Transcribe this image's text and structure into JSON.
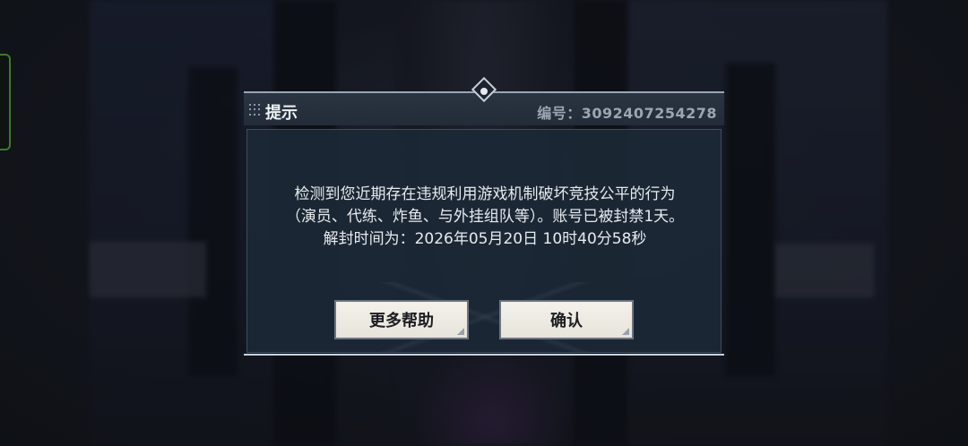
{
  "dialog": {
    "title": "提示",
    "id_text": "编号：3092407254278",
    "message_lines": [
      "检测到您近期存在违规利用游戏机制破坏竞技公平的行为",
      "（演员、代练、炸鱼、与外挂组队等）。账号已被封禁1天。",
      "解封时间为：2026年05月20日 10时40分58秒"
    ],
    "buttons": {
      "help": "更多帮助",
      "confirm": "确认"
    }
  },
  "colors": {
    "header_bg": "#232c38",
    "body_bg": "#1c2836",
    "button_bg": "#f3f1ea",
    "edge_tab_border": "#3d7a2e"
  }
}
